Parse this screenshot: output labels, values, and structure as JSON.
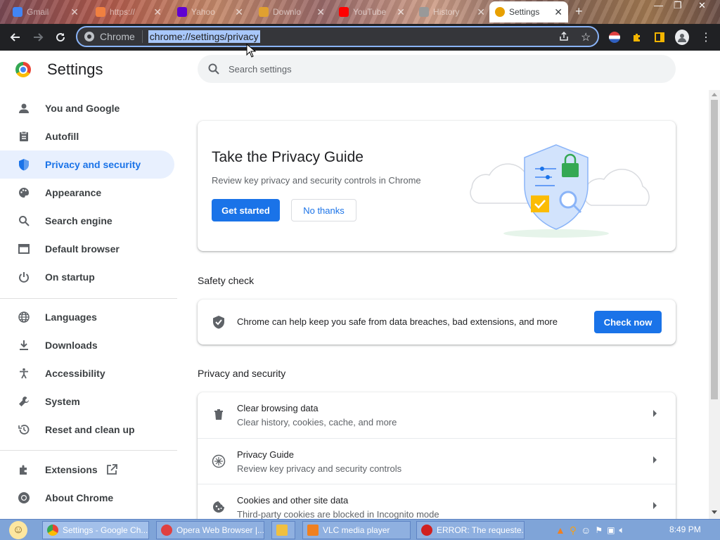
{
  "tabs": [
    {
      "label": "Gmail",
      "color": "#4285f4"
    },
    {
      "label": "https://",
      "color": "#f08040"
    },
    {
      "label": "Yahoo",
      "color": "#6001d2"
    },
    {
      "label": "Downlo",
      "color": "#e0a030"
    },
    {
      "label": "YouTube",
      "color": "#ff0000"
    },
    {
      "label": "History",
      "color": "#999999"
    },
    {
      "label": "Settings",
      "color": "#e8a000"
    }
  ],
  "toolbar": {
    "chip_label": "Chrome",
    "url": "chrome://settings/privacy"
  },
  "header": {
    "title": "Settings",
    "search_placeholder": "Search settings"
  },
  "sidebar": {
    "items": [
      {
        "label": "You and Google",
        "icon": "person-icon"
      },
      {
        "label": "Autofill",
        "icon": "clipboard-icon"
      },
      {
        "label": "Privacy and security",
        "icon": "shield-icon"
      },
      {
        "label": "Appearance",
        "icon": "palette-icon"
      },
      {
        "label": "Search engine",
        "icon": "search-icon"
      },
      {
        "label": "Default browser",
        "icon": "browser-icon"
      },
      {
        "label": "On startup",
        "icon": "power-icon"
      },
      {
        "label": "Languages",
        "icon": "globe-icon"
      },
      {
        "label": "Downloads",
        "icon": "download-icon"
      },
      {
        "label": "Accessibility",
        "icon": "accessibility-icon"
      },
      {
        "label": "System",
        "icon": "wrench-icon"
      },
      {
        "label": "Reset and clean up",
        "icon": "history-icon"
      },
      {
        "label": "Extensions",
        "icon": "puzzle-icon"
      },
      {
        "label": "About Chrome",
        "icon": "chrome-icon"
      }
    ]
  },
  "privacy_guide": {
    "title": "Take the Privacy Guide",
    "description": "Review key privacy and security controls in Chrome",
    "get_started": "Get started",
    "no_thanks": "No thanks"
  },
  "safety_check": {
    "heading": "Safety check",
    "text": "Chrome can help keep you safe from data breaches, bad extensions, and more",
    "button": "Check now"
  },
  "privacy_section": {
    "heading": "Privacy and security",
    "rows": [
      {
        "title": "Clear browsing data",
        "subtitle": "Clear history, cookies, cache, and more",
        "icon": "trash-icon"
      },
      {
        "title": "Privacy Guide",
        "subtitle": "Review key privacy and security controls",
        "icon": "compass-icon"
      },
      {
        "title": "Cookies and other site data",
        "subtitle": "Third-party cookies are blocked in Incognito mode",
        "icon": "cookie-icon"
      }
    ]
  },
  "taskbar": {
    "tasks": [
      {
        "label": "Settings - Google Ch...",
        "color": "#4285f4"
      },
      {
        "label": "Opera Web Browser |...",
        "color": "#e04040"
      },
      {
        "label": "",
        "color": "#f0c040"
      },
      {
        "label": "VLC media player",
        "color": "#f08020"
      },
      {
        "label": "ERROR: The requeste...",
        "color": "#d02020"
      }
    ],
    "clock": "8:49 PM"
  },
  "colors": {
    "accent": "#1a73e8",
    "active_nav_bg": "#e8f0fe"
  }
}
